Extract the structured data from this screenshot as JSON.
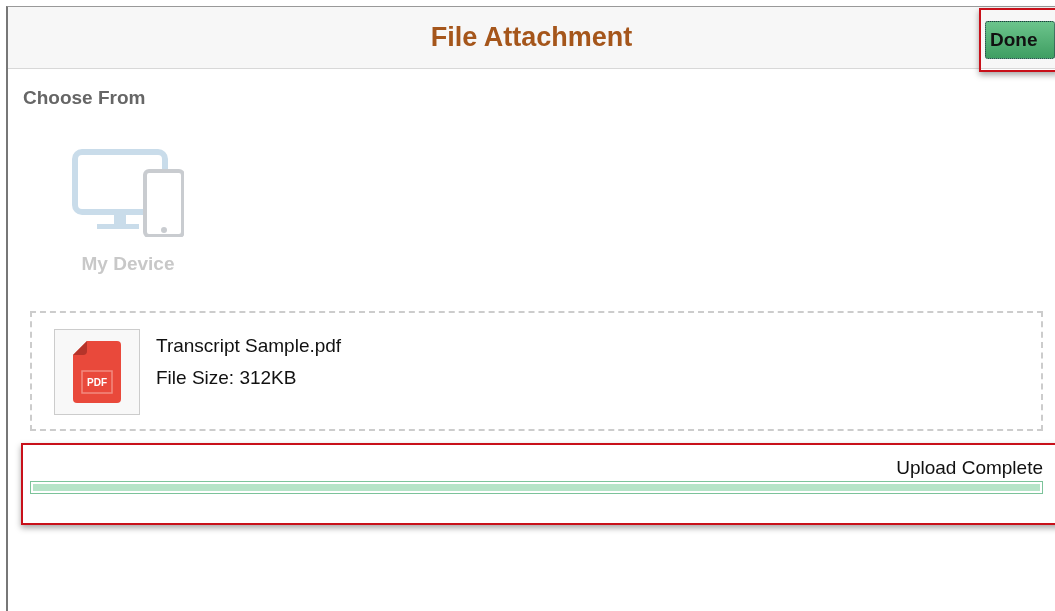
{
  "dialog": {
    "title": "File Attachment",
    "done_button": "Done"
  },
  "choose_from": {
    "heading": "Choose From",
    "source": "My Device"
  },
  "file": {
    "name": "Transcript Sample.pdf",
    "size": "File Size: 312KB",
    "type_label": "PDF"
  },
  "upload": {
    "status": "Upload Complete",
    "level": 1
  }
}
